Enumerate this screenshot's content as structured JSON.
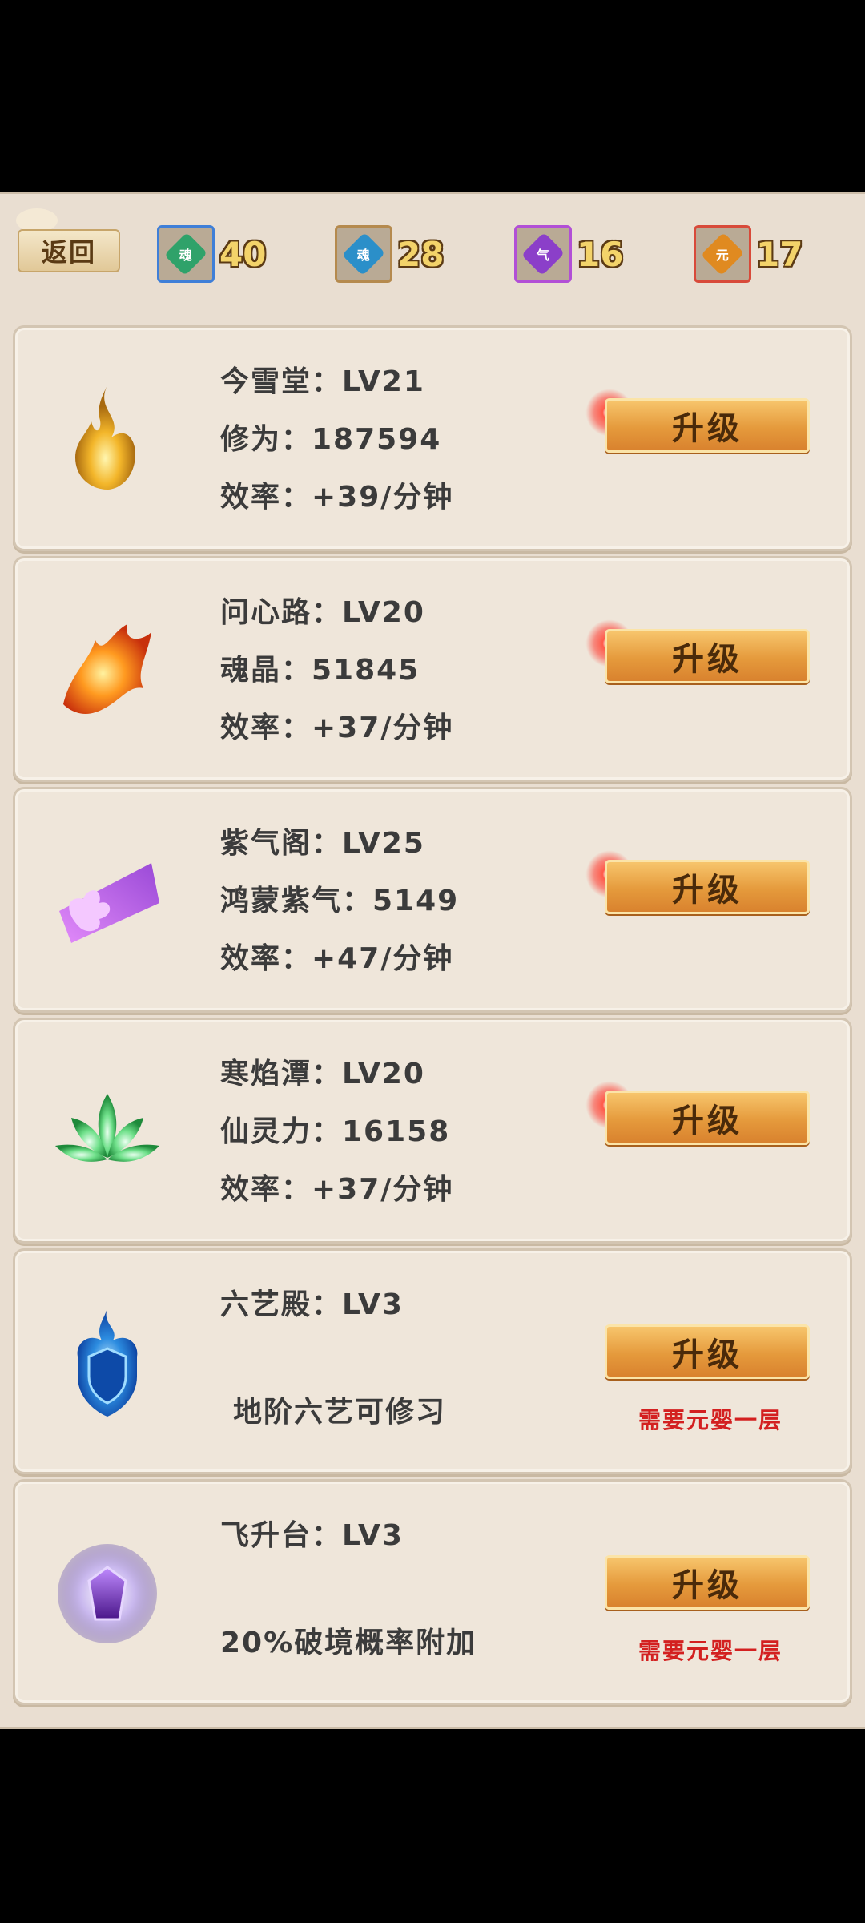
{
  "topbar": {
    "back_label": "返回",
    "resources": [
      {
        "icon": "green-gem-icon",
        "glyph": "魂",
        "value": "40",
        "border": "#3f7fd8",
        "color": "#2fa26a"
      },
      {
        "icon": "blue-gem-icon",
        "glyph": "魂",
        "value": "28",
        "border": "#b58a4e",
        "color": "#2b8fc9"
      },
      {
        "icon": "purple-gem-icon",
        "glyph": "气",
        "value": "16",
        "border": "#b24fd6",
        "color": "#8b3fc9"
      },
      {
        "icon": "orange-gem-icon",
        "glyph": "元",
        "value": "17",
        "border": "#d84a3a",
        "color": "#e08a20"
      }
    ]
  },
  "cards": [
    {
      "icon": "golden-flame-icon",
      "title": "今雪堂：LV21",
      "line2": "修为：187594",
      "line3": "效率：+39/分钟",
      "button": "升级"
    },
    {
      "icon": "fire-phoenix-icon",
      "title": "问心路：LV20",
      "line2": "魂晶：51845",
      "line3": "效率：+37/分钟",
      "button": "升级"
    },
    {
      "icon": "purple-butterfly-icon",
      "title": "紫气阁：LV25",
      "line2": "鸿蒙紫气：5149",
      "line3": "效率：+47/分钟",
      "button": "升级"
    },
    {
      "icon": "green-lotus-icon",
      "title": "寒焰潭：LV20",
      "line2": "仙灵力：16158",
      "line3": "效率：+37/分钟",
      "button": "升级"
    },
    {
      "icon": "blue-flame-shield-icon",
      "title": "六艺殿：LV3",
      "note": "地阶六艺可修习",
      "button": "升级",
      "requirement": "需要元婴一层"
    },
    {
      "icon": "purple-crystal-icon",
      "title": "飞升台：LV3",
      "note": "20%破境概率附加",
      "button": "升级",
      "requirement": "需要元婴一层"
    }
  ]
}
